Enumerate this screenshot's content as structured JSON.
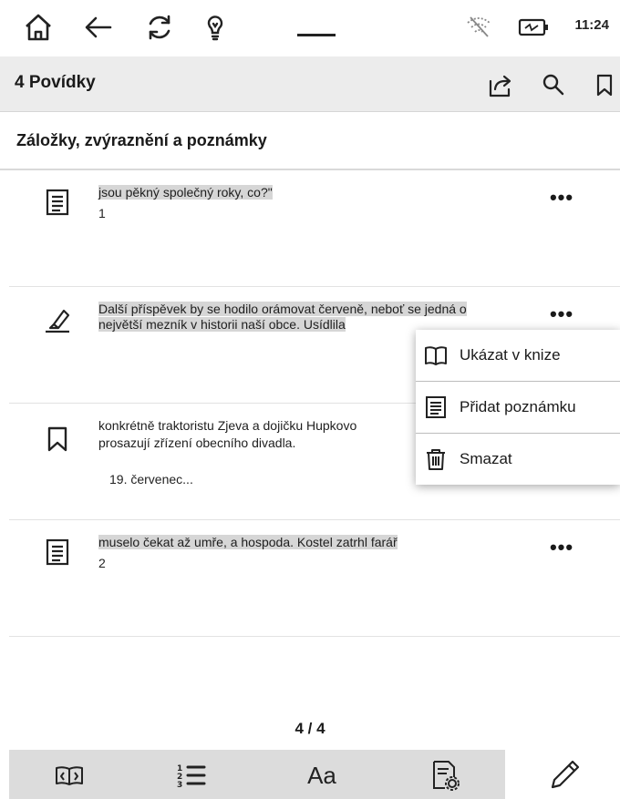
{
  "status_bar": {
    "time": "11:24",
    "icons": [
      "home-icon",
      "back-icon",
      "sync-icon",
      "frontlight-icon",
      "handle-icon",
      "wifi-off-icon",
      "battery-charging-icon"
    ]
  },
  "header": {
    "title": "4 Povídky",
    "actions": [
      "share-icon",
      "search-icon",
      "bookmark-icon"
    ]
  },
  "section": {
    "title": "Záložky, zvýraznění a poznámky"
  },
  "items": [
    {
      "type": "note",
      "icon": "note-icon",
      "text": "jsou pěkný společný roky, co?\"",
      "sub": "1",
      "highlighted": true
    },
    {
      "type": "highlight",
      "icon": "highlighter-icon",
      "text": "Další příspěvek by se hodilo orámovat červeně, neboť se jedná o největší mezník v historii naší obce. Usídlila",
      "highlighted": true
    },
    {
      "type": "bookmark",
      "icon": "bookmark-icon",
      "text": "konkrétně traktoristu Zjeva a dojičku Hupkovo",
      "text2": "prosazují zřízení obecního divadla.",
      "date": "19. červenec...",
      "highlighted": false
    },
    {
      "type": "note",
      "icon": "note-icon",
      "text": "muselo čekat až umře, a hospoda. Kostel zatrhl farář",
      "sub": "2",
      "highlighted": true
    }
  ],
  "more_label": "•••",
  "context_menu": {
    "items": [
      {
        "label": "Ukázat v knize",
        "icon": "open-book-icon"
      },
      {
        "label": "Přidat poznámku",
        "icon": "add-note-icon"
      },
      {
        "label": "Smazat",
        "icon": "trash-icon"
      }
    ]
  },
  "pager": {
    "label": "4 / 4"
  },
  "bottom_bar": {
    "buttons": [
      "page-turn-icon",
      "table-of-contents-icon",
      "font-settings-icon",
      "document-settings-icon"
    ],
    "font_label": "Aa",
    "pen": "pen-icon"
  }
}
